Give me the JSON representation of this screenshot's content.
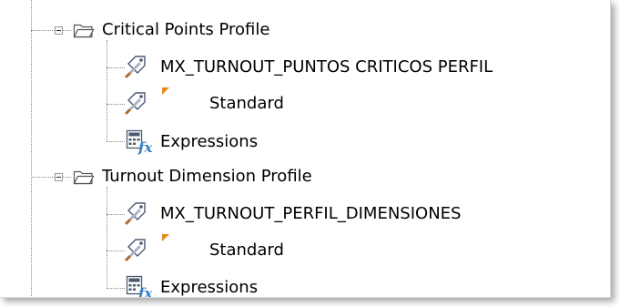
{
  "tree": {
    "groups": [
      {
        "label": "Critical Points Profile",
        "icon": "folder-icon",
        "children": [
          {
            "label": "MX_TURNOUT_PUNTOS CRITICOS PERFIL",
            "icon": "label-style-icon"
          },
          {
            "label": "Standard",
            "icon": "label-style-icon",
            "flag_color": "#e6891d"
          },
          {
            "label": "Expressions",
            "icon": "expressions-icon"
          }
        ]
      },
      {
        "label": "Turnout Dimension Profile",
        "icon": "folder-icon",
        "children": [
          {
            "label": "MX_TURNOUT_PERFIL_DIMENSIONES",
            "icon": "label-style-icon"
          },
          {
            "label": "Standard",
            "icon": "label-style-icon",
            "flag_color": "#e6891d"
          },
          {
            "label": "Expressions",
            "icon": "expressions-icon"
          }
        ]
      }
    ]
  }
}
